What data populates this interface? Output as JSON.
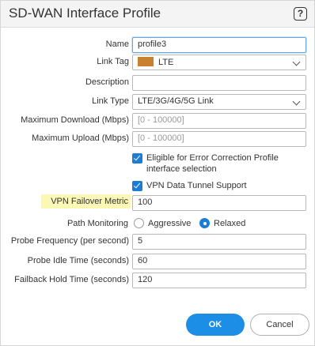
{
  "dialog": {
    "title": "SD-WAN Interface Profile",
    "help_glyph": "?",
    "help_icon": "question-mark-icon"
  },
  "form": {
    "name": {
      "label": "Name",
      "value": "profile3"
    },
    "link_tag": {
      "label": "Link Tag",
      "value": "LTE",
      "tag_color": "#c9812f"
    },
    "description": {
      "label": "Description",
      "value": ""
    },
    "link_type": {
      "label": "Link Type",
      "value": "LTE/3G/4G/5G Link"
    },
    "max_download": {
      "label": "Maximum Download (Mbps)",
      "placeholder": "[0 - 100000]"
    },
    "max_upload": {
      "label": "Maximum Upload (Mbps)",
      "placeholder": "[0 - 100000]"
    },
    "error_correction": {
      "label_line1": "Eligible for Error Correction Profile",
      "label_line2": "interface selection",
      "checked": true
    },
    "vpn_tunnel": {
      "label": "VPN Data Tunnel Support",
      "checked": true
    },
    "vpn_failover_metric": {
      "label": "VPN Failover Metric",
      "value": "100"
    },
    "path_monitoring": {
      "label": "Path Monitoring",
      "options": [
        "Aggressive",
        "Relaxed"
      ],
      "selected": "Relaxed"
    },
    "probe_frequency": {
      "label": "Probe Frequency (per second)",
      "value": "5"
    },
    "probe_idle_time": {
      "label": "Probe Idle Time (seconds)",
      "value": "60"
    },
    "failback_hold_time": {
      "label": "Failback Hold Time (seconds)",
      "value": "120"
    }
  },
  "buttons": {
    "ok": "OK",
    "cancel": "Cancel"
  },
  "colors": {
    "accent": "#1c8ee6",
    "highlight": "#fbf7b6"
  }
}
